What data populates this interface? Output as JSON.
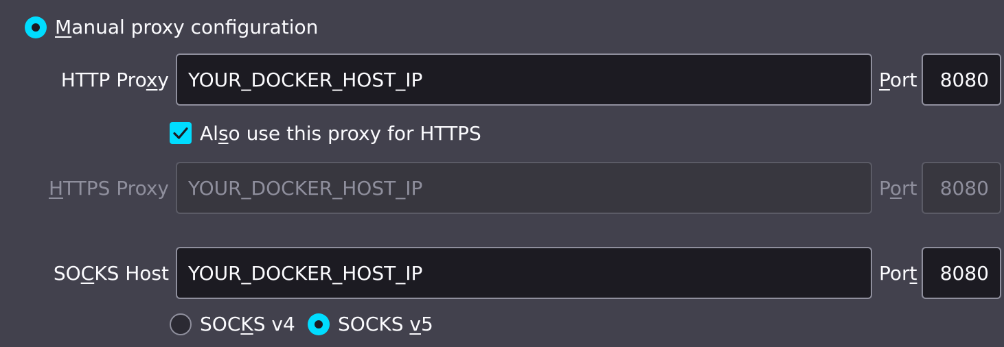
{
  "manual_proxy": {
    "pre": "",
    "accel": "M",
    "post": "anual proxy configuration",
    "selected": true
  },
  "http_proxy": {
    "label_pre": "HTTP Pro",
    "label_accel": "x",
    "label_post": "y",
    "value": "YOUR_DOCKER_HOST_IP",
    "port_label_pre": "",
    "port_label_accel": "P",
    "port_label_post": "ort",
    "port": "8080"
  },
  "also_https": {
    "pre": "Al",
    "accel": "s",
    "post": "o use this proxy for HTTPS",
    "checked": true
  },
  "https_proxy": {
    "label_pre": "",
    "label_accel": "H",
    "label_post": "TTPS Proxy",
    "value": "YOUR_DOCKER_HOST_IP",
    "port_label_pre": "P",
    "port_label_accel": "o",
    "port_label_post": "rt",
    "port": "8080",
    "disabled": true
  },
  "socks_host": {
    "label_pre": "SO",
    "label_accel": "C",
    "label_post": "KS Host",
    "value": "YOUR_DOCKER_HOST_IP",
    "port_label_pre": "Por",
    "port_label_accel": "t",
    "port_label_post": "",
    "port": "8080"
  },
  "socks_v4": {
    "pre": "SOC",
    "accel": "K",
    "post": "S v4",
    "selected": false
  },
  "socks_v5": {
    "pre": "SOCKS ",
    "accel": "v",
    "post": "5",
    "selected": true
  },
  "colors": {
    "background": "#42414d",
    "accent": "#00ddff",
    "input_bg": "#1c1b22",
    "text": "#fbfbfe",
    "disabled_text": "#8f8f9d"
  }
}
